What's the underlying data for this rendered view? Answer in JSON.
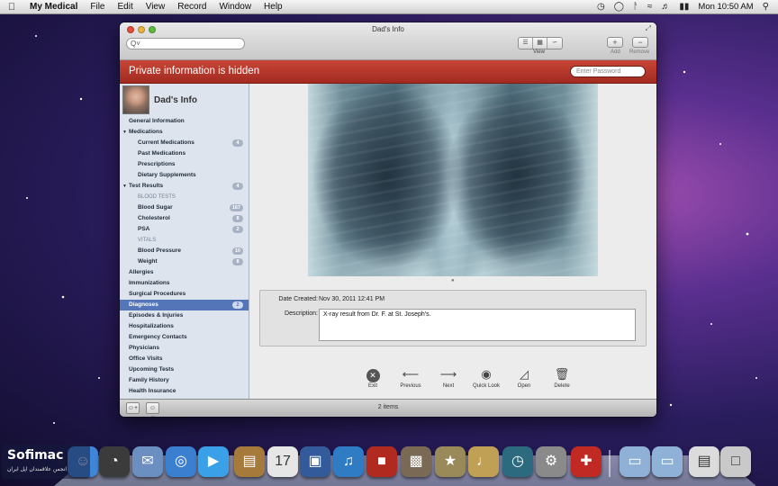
{
  "menubar": {
    "app_name": "My Medical",
    "menus": [
      "File",
      "Edit",
      "View",
      "Record",
      "Window",
      "Help"
    ],
    "clock": "Mon 10:50 AM"
  },
  "window": {
    "title": "Dad's Info",
    "search_placeholder": "Q˅",
    "toolbar": {
      "view_label": "View",
      "add_label": "Add",
      "remove_label": "Remove"
    },
    "banner": {
      "text": "Private information is hidden",
      "password_placeholder": "Enter Password"
    },
    "profile_name": "Dad's Info",
    "nav": [
      {
        "label": "General Information",
        "level": 0
      },
      {
        "label": "Medications",
        "level": 0,
        "expanded": true
      },
      {
        "label": "Current Medications",
        "level": 1,
        "badge": "4"
      },
      {
        "label": "Past Medications",
        "level": 1
      },
      {
        "label": "Prescriptions",
        "level": 1
      },
      {
        "label": "Dietary Supplements",
        "level": 1
      },
      {
        "label": "Test Results",
        "level": 0,
        "expanded": true,
        "badge": "4"
      },
      {
        "label": "BLOOD TESTS",
        "level": 2
      },
      {
        "label": "Blood Sugar",
        "level": 1,
        "badge": "167"
      },
      {
        "label": "Cholesterol",
        "level": 1,
        "badge": "8"
      },
      {
        "label": "PSA",
        "level": 1,
        "badge": "2"
      },
      {
        "label": "VITALS",
        "level": 2
      },
      {
        "label": "Blood Pressure",
        "level": 1,
        "badge": "10"
      },
      {
        "label": "Weight",
        "level": 1,
        "badge": "8"
      },
      {
        "label": "Allergies",
        "level": 0
      },
      {
        "label": "Immunizations",
        "level": 0
      },
      {
        "label": "Surgical Procedures",
        "level": 0
      },
      {
        "label": "Diagnoses",
        "level": 0,
        "badge": "2",
        "selected": true
      },
      {
        "label": "Episodes & Injuries",
        "level": 0
      },
      {
        "label": "Hospitalizations",
        "level": 0
      },
      {
        "label": "Emergency Contacts",
        "level": 0
      },
      {
        "label": "Physicians",
        "level": 0
      },
      {
        "label": "Office Visits",
        "level": 0
      },
      {
        "label": "Upcoming Tests",
        "level": 0
      },
      {
        "label": "Family History",
        "level": 0
      },
      {
        "label": "Health Insurance",
        "level": 0
      }
    ],
    "details": {
      "date_label": "Date Created:",
      "date_value": "Nov 30, 2011 12:41 PM",
      "desc_label": "Description:",
      "desc_value": "X-ray result from Dr. F. at St. Joseph's."
    },
    "actions": [
      {
        "label": "Exit",
        "icon": "exit-icon"
      },
      {
        "label": "Previous",
        "icon": "arrow-left-icon"
      },
      {
        "label": "Next",
        "icon": "arrow-right-icon"
      },
      {
        "label": "Quick Look",
        "icon": "eye-icon"
      },
      {
        "label": "Open",
        "icon": "open-icon"
      },
      {
        "label": "Delete",
        "icon": "trash-icon"
      }
    ],
    "status": {
      "items": "2 items"
    }
  },
  "dock": [
    {
      "name": "finder-icon",
      "color": "#3f86d9"
    },
    {
      "name": "dashboard-icon",
      "color": "#3b3b3b"
    },
    {
      "name": "mail-icon",
      "color": "#6a8fc0"
    },
    {
      "name": "safari-icon",
      "color": "#3a7fd0"
    },
    {
      "name": "facetime-icon",
      "color": "#3aa0e8"
    },
    {
      "name": "address-book-icon",
      "color": "#a57a3a"
    },
    {
      "name": "ical-icon",
      "color": "#e6e6e6"
    },
    {
      "name": "photo-booth-icon",
      "color": "#335a9a"
    },
    {
      "name": "itunes-icon",
      "color": "#2f7cc4"
    },
    {
      "name": "photo-booth-red-icon",
      "color": "#b12a1f"
    },
    {
      "name": "iphoto-icon",
      "color": "#7a6a55"
    },
    {
      "name": "imovie-icon",
      "color": "#9a8a5a"
    },
    {
      "name": "garageband-icon",
      "color": "#c0a055"
    },
    {
      "name": "time-machine-icon",
      "color": "#2b6a7f"
    },
    {
      "name": "system-preferences-icon",
      "color": "#8a8a8a"
    },
    {
      "name": "my-medical-icon",
      "color": "#c02a22"
    },
    {
      "name": "applications-folder-icon",
      "color": "#8fb1d8"
    },
    {
      "name": "documents-folder-icon",
      "color": "#8fb1d8"
    },
    {
      "name": "pdf-document-icon",
      "color": "#dcdcdc"
    },
    {
      "name": "trash-can-icon",
      "color": "#c9c9c9"
    }
  ],
  "watermark": {
    "brand": "Sofimac",
    "subtitle": "انجمن علاقمندان اپل ایران"
  }
}
